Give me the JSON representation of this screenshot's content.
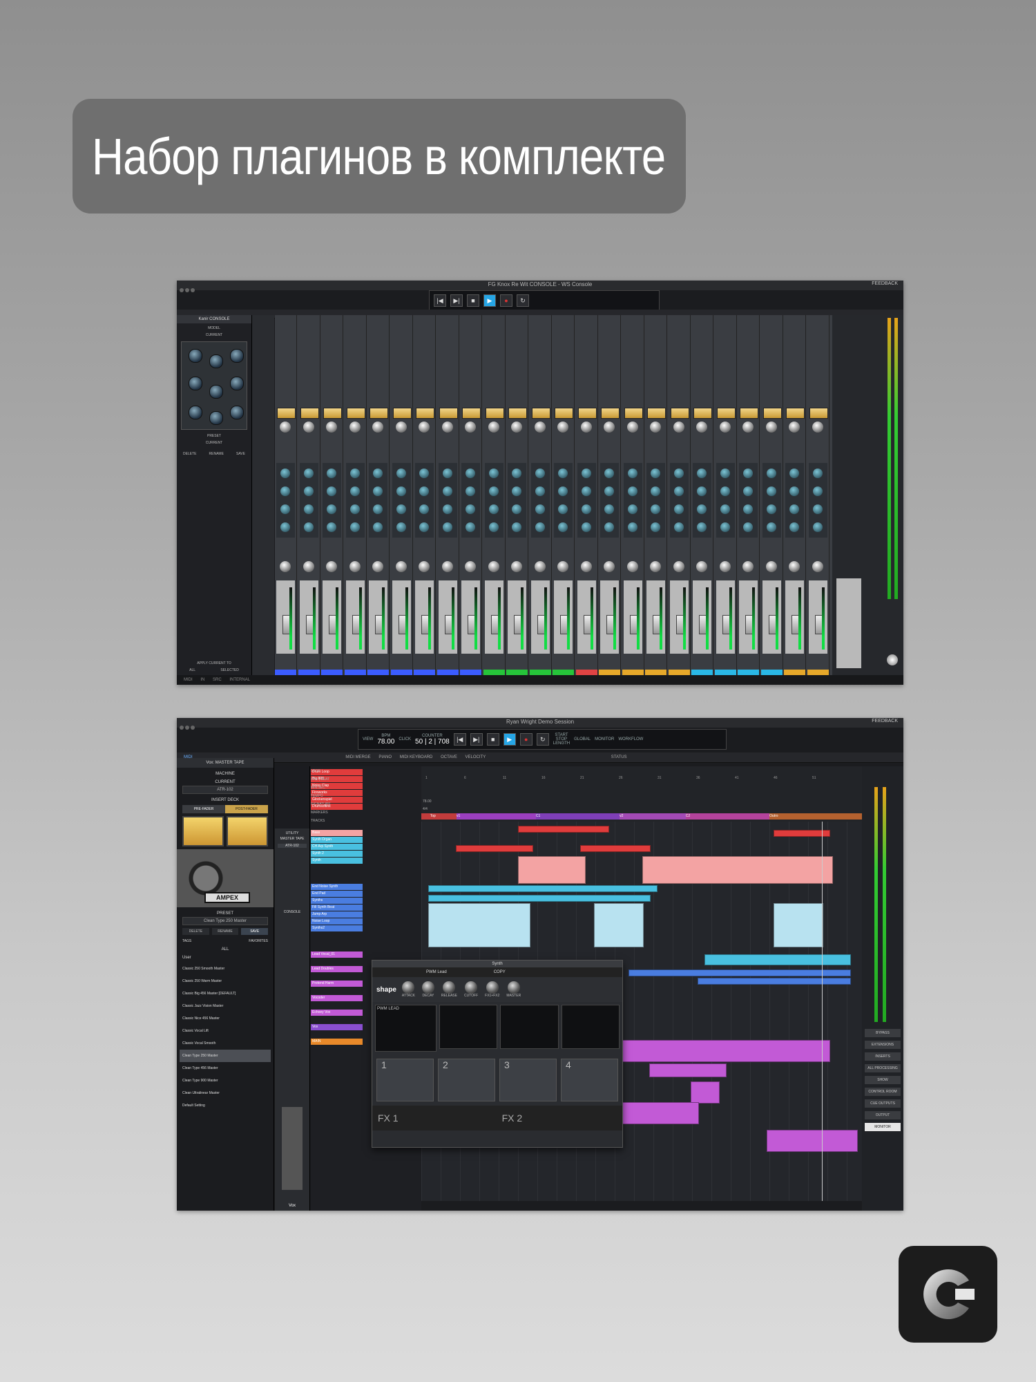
{
  "headline": "Набор плагинов в комплекте",
  "shot1": {
    "window_title": "FG Knox Re Wit CONSOLE - WS Console",
    "feedback": "FEEDBACK",
    "sidebar_title": "Kanir CONSOLE",
    "sidebar_labels": [
      "MODEL",
      "CURRENT",
      "PRESET",
      "CURRENT",
      "DELETE",
      "RENAME",
      "SAVE",
      "APPLY CURRENT TO",
      "ALL",
      "SELECTED"
    ],
    "status_items": [
      "MIDI",
      "IN",
      "SRC",
      "INTERNAL"
    ]
  },
  "shot2": {
    "window_title": "Ryan Wright Demo Session",
    "feedback": "FEEDBACK",
    "transport": {
      "view_label": "VIEW",
      "bpm_label": "BPM",
      "bpm": "78.00",
      "click_label": "CLICK",
      "counter_label": "COUNTER",
      "counter": "50 | 2 | 708",
      "start_label": "START",
      "stop_label": "STOP",
      "length_label": "LENGTH",
      "global_label": "GLOBAL",
      "monitor_label": "MONITOR",
      "workflow_label": "WORKFLOW"
    },
    "sub_items": [
      "MIDI",
      "MIDI MERGE",
      "PIANO",
      "MIDI KEYBOARD",
      "OCTAVE",
      "VELOCITY",
      "STATUS"
    ],
    "sidebar": {
      "title": "Vox: MASTER TAPE",
      "machine_label": "MACHINE",
      "current_label": "CURRENT",
      "current_value": "ATR-102",
      "insert_deck_label": "INSERT DECK",
      "pre_fader": "PRE-FADER",
      "post_fader": "POST-FADER",
      "brand": "AMPEX",
      "preset_label": "PRESET",
      "preset_value": "Clean Type 250 Master",
      "delete": "DELETE",
      "rename": "RENAME",
      "save": "SAVE",
      "tags": "TAGS",
      "favorites": "FAVORITES",
      "all": "ALL",
      "user": "User",
      "presets": [
        "Classic 250 Smooth Master",
        "Classic 250 Warm Master",
        "Classic Big 456 Master [DEFAULT]",
        "Classic Jazz Vision Master",
        "Classic Nice 456 Master",
        "Classic Vocal Lift",
        "Classic Vocal Smooth",
        "Clean Type 250 Master",
        "Clean Type 456 Master",
        "Clean Type 900 Master",
        "Clean Ultralinear Master",
        "Default Setting"
      ],
      "selected_preset": "Clean Type 250 Master"
    },
    "channel_labels": [
      "UTILITY",
      "MASTER TAPE",
      "ATR-102",
      "CONSOLE",
      "Vox"
    ],
    "tracks": [
      {
        "name": "Drum Loop",
        "color": "#e03c3c"
      },
      {
        "name": "Big 808",
        "color": "#e03c3c"
      },
      {
        "name": "Noisy Clap",
        "color": "#e03c3c"
      },
      {
        "name": "Fireworks",
        "color": "#e03c3c"
      },
      {
        "name": "Glockenspiel",
        "color": "#e03c3c"
      },
      {
        "name": "Drumsoftinx",
        "color": "#e03c3c"
      },
      {
        "name": "Bass",
        "color": "#f3a3a3"
      },
      {
        "name": "Synth Organ",
        "color": "#49c0e0"
      },
      {
        "name": "CH Arp Synth",
        "color": "#49c0e0"
      },
      {
        "name": "Synth 2",
        "color": "#49c0e0"
      },
      {
        "name": "Synth",
        "color": "#49c0e0"
      },
      {
        "name": "End Noise Synth",
        "color": "#4a7de0"
      },
      {
        "name": "End Pad",
        "color": "#4a7de0"
      },
      {
        "name": "Synths",
        "color": "#4a7de0"
      },
      {
        "name": "Fill Synth Beat",
        "color": "#4a7de0"
      },
      {
        "name": "Jump Arp",
        "color": "#4a7de0"
      },
      {
        "name": "Noise Loop",
        "color": "#4a7de0"
      },
      {
        "name": "Synths2",
        "color": "#4a7de0"
      },
      {
        "name": "Lead Vocal_01",
        "color": "#c25ad6"
      },
      {
        "name": "Lead Doubles",
        "color": "#c25ad6"
      },
      {
        "name": "Pretend Harm",
        "color": "#c25ad6"
      },
      {
        "name": "Vocoder",
        "color": "#c25ad6"
      },
      {
        "name": "Echoey Vox",
        "color": "#c25ad6"
      },
      {
        "name": "Vox",
        "color": "#8a4fd0"
      },
      {
        "name": "MAIN",
        "color": "#e8892a"
      }
    ],
    "ruler": {
      "loop": "LOOP",
      "bar_beat": "BAR | BEAT",
      "min_sec": "MIN:SEC",
      "tempo": "TEMPO",
      "tempo_value": "78.00",
      "signature": "SIGNATURE",
      "signature_value": "4/4",
      "markers": "MARKERS",
      "tracks_label": "TRACKS",
      "marker_names": [
        "Top",
        "v1",
        "C1",
        "v2",
        "C2",
        "Outro"
      ],
      "bar_numbers": [
        "1",
        "6",
        "11",
        "16",
        "21",
        "26",
        "31",
        "36",
        "41",
        "46",
        "51"
      ]
    },
    "synth": {
      "title": "Synth",
      "preset": "PWM Lead",
      "copy": "COPY",
      "brand": "shape",
      "knobs": [
        "ATTACK",
        "DECAY",
        "RELEASE",
        "CUTOFF",
        "FX1+FX2",
        "MASTER"
      ],
      "lcd_label": "PWM LEAD",
      "layers": [
        "1",
        "2",
        "3",
        "4"
      ],
      "fx": [
        "FX 1",
        "FX 2"
      ]
    },
    "right_panel": [
      "BYPASS",
      "EXTENSIONS",
      "INSERTS",
      "ALL PROCESSING",
      "SHOW",
      "CONTROL ROOM",
      "CUE OUTPUTS",
      "OUTPUT",
      "MONITOR"
    ]
  },
  "colors": {
    "accent_blue": "#26a6e6",
    "tape_vu": "#e9c261",
    "background_top": "#8f8f8f",
    "background_bottom": "#dcdcdc"
  }
}
